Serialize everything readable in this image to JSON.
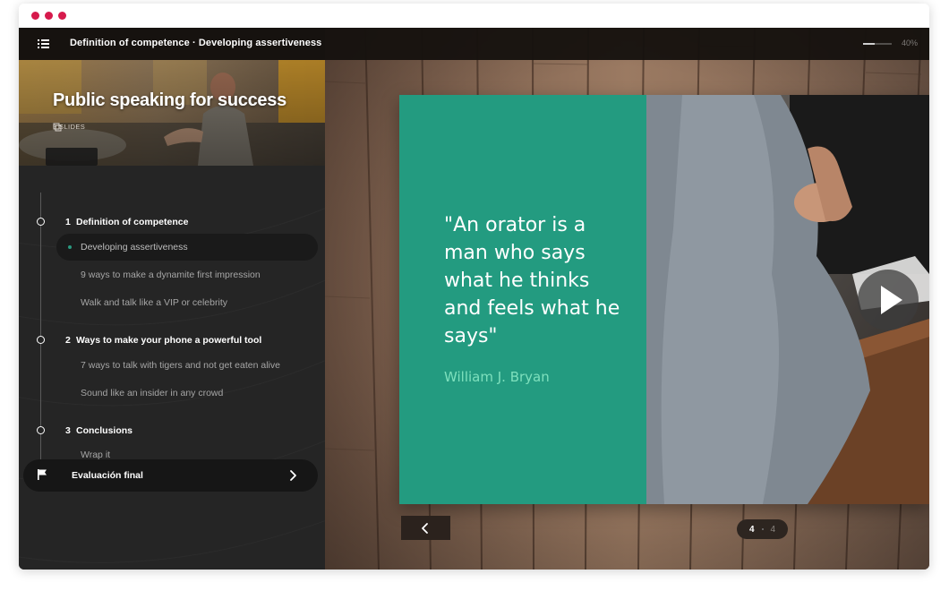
{
  "window": {
    "controls": [
      "close",
      "minimize",
      "maximize"
    ],
    "dot_color": "#d61a4c"
  },
  "topbar": {
    "menu_icon": "hamburger-menu-icon",
    "title": "Definition of competence · Developing assertiveness",
    "progress_fraction": 0.4,
    "progress_label": "40%"
  },
  "course": {
    "title": "Public speaking for success",
    "slides_label": "9 SLIDES",
    "slides_icon": "copy-icon"
  },
  "toc": {
    "sections": [
      {
        "number": "1",
        "title": "Definition of competence",
        "lessons": [
          {
            "title": "Developing assertiveness",
            "active": true
          },
          {
            "title": "9 ways to make a dynamite first impression",
            "active": false
          },
          {
            "title": "Walk and talk like a VIP or celebrity",
            "active": false
          }
        ]
      },
      {
        "number": "2",
        "title": "Ways to make your phone a powerful tool",
        "lessons": [
          {
            "title": "7 ways to talk with tigers and not get eaten alive",
            "active": false
          },
          {
            "title": "Sound like an insider in any crowd",
            "active": false
          }
        ]
      },
      {
        "number": "3",
        "title": "Conclusions",
        "lessons": [
          {
            "title": "Wrap it",
            "active": false
          }
        ]
      }
    ],
    "final_evaluation": {
      "label": "Evaluación final",
      "icon": "flag-icon",
      "chevron_icon": "chevron-right-icon"
    }
  },
  "slide": {
    "quote": "\"An orator is a man who says what he thinks and feels what he says\"",
    "author": "William J. Bryan",
    "quote_bg": "#239b80",
    "author_color": "#7ee0bd",
    "play_icon": "play-icon"
  },
  "navigation": {
    "prev_icon": "chevron-left-icon",
    "current_page": "4",
    "total_pages": "4"
  }
}
